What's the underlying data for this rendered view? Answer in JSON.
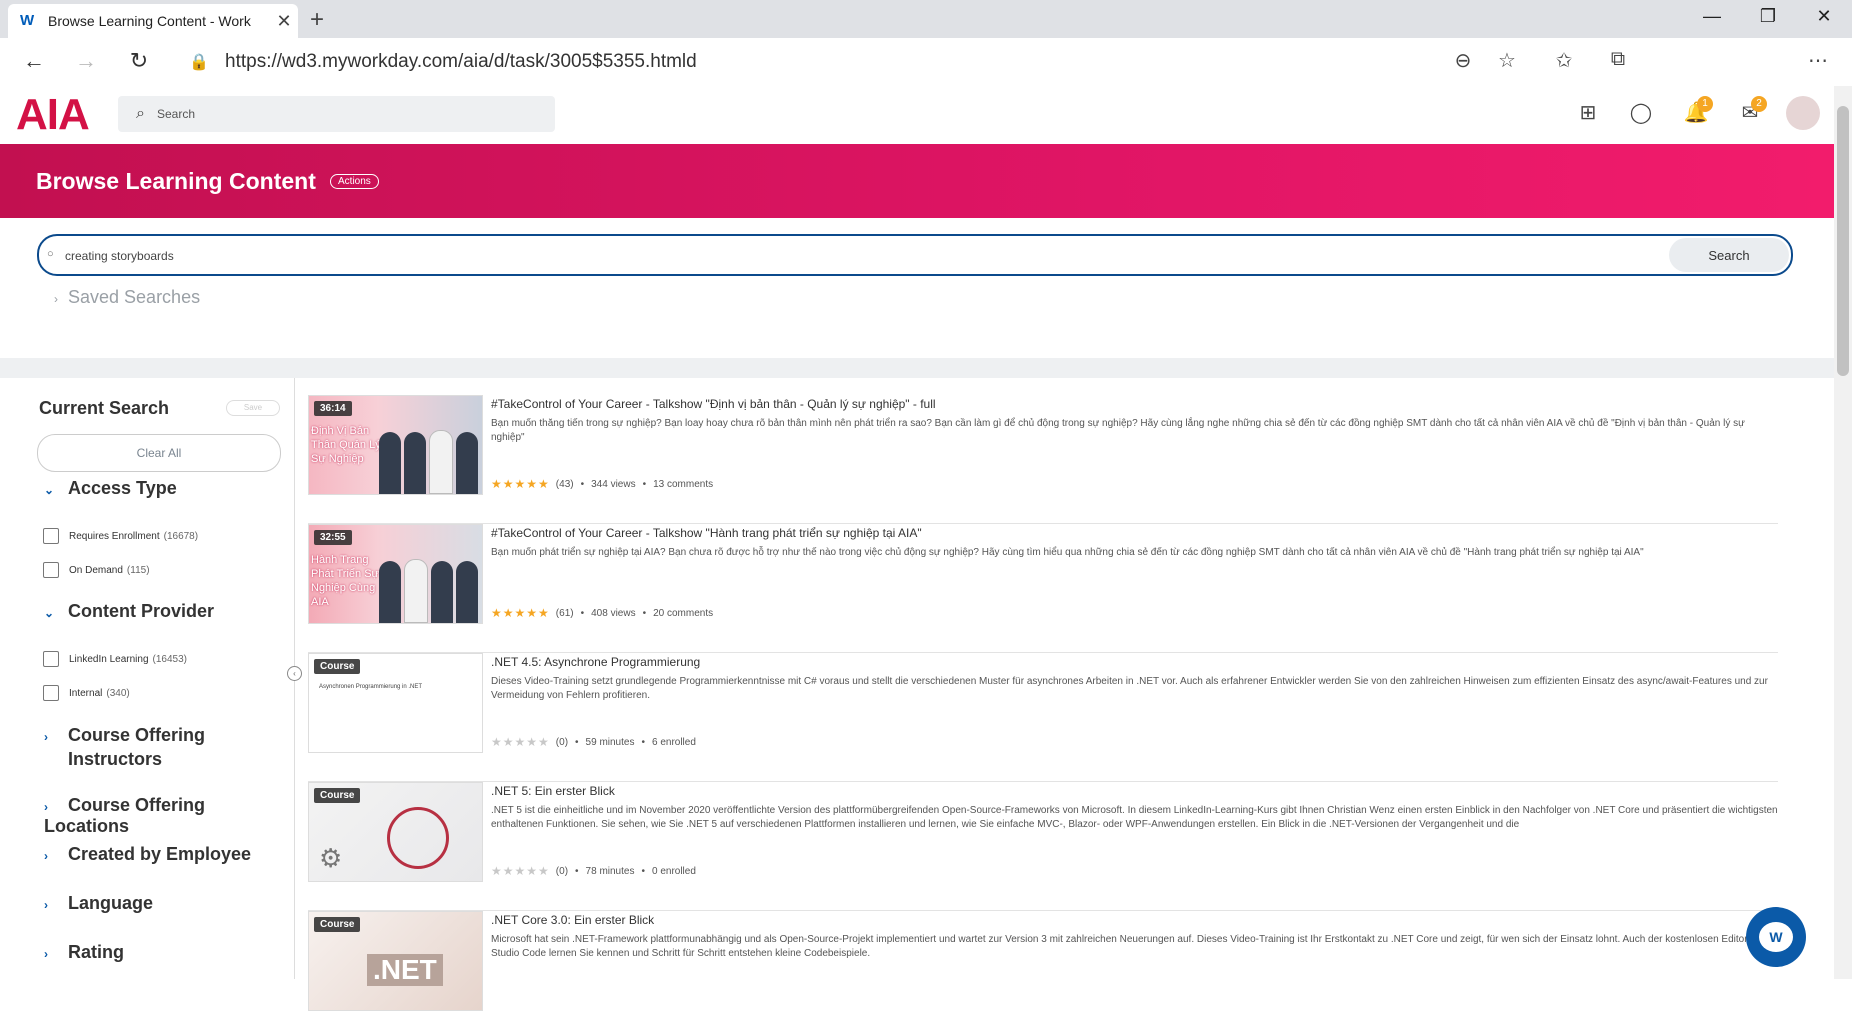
{
  "browser": {
    "tab_title": "Browse Learning Content - Work",
    "tab_favicon": "W",
    "url": "https://wd3.myworkday.com/aia/d/task/3005$5355.htmld"
  },
  "header": {
    "logo": "AIA",
    "search_placeholder": "Search",
    "notifications_badge": "1",
    "inbox_badge": "2"
  },
  "banner": {
    "title": "Browse Learning Content",
    "actions_label": "Actions"
  },
  "search": {
    "value": "creating storyboards",
    "button": "Search",
    "saved_searches": "Saved Searches"
  },
  "sidebar": {
    "current_search": "Current Search",
    "save_label": "Save",
    "clear_all": "Clear All",
    "facets": {
      "access_type": "Access Type",
      "content_provider": "Content Provider",
      "course_offering_instructors_1": "Course Offering",
      "course_offering_instructors_2": "Instructors",
      "course_offering_locations": "Course Offering Locations",
      "created_by_employee": "Created by Employee",
      "language": "Language",
      "rating": "Rating"
    },
    "options": {
      "requires_enrollment": "Requires Enrollment",
      "requires_enrollment_count": "(16678)",
      "on_demand": "On Demand",
      "on_demand_count": "(115)",
      "linkedin": "LinkedIn Learning",
      "linkedin_count": "(16453)",
      "internal": "Internal",
      "internal_count": "(340)"
    }
  },
  "results": [
    {
      "tag": "36:14",
      "thumb_caption": "Định Vị Bản Thân Quản Lý Sự Nghiệp",
      "title": "#TakeControl of Your Career - Talkshow \"Định vị bản thân - Quản lý sự nghiệp\" - full",
      "description": "Bạn muốn thăng tiến trong sự nghiệp? Bạn loay hoay chưa rõ bản thân mình nên phát triển ra sao? Bạn cần làm gì để chủ động trong sự nghiệp? Hãy cùng lắng nghe những chia sẻ đến từ các đồng nghiệp SMT dành cho tất cả nhân viên AIA về chủ đề \"Định vị bản thân - Quản lý sự nghiệp\"",
      "stars": "★★★★★",
      "rating_count": "(43)",
      "stat2": "344 views",
      "stat3": "13 comments"
    },
    {
      "tag": "32:55",
      "thumb_caption": "Hành Trang Phát Triển Sự Nghiệp Cùng AIA",
      "title": "#TakeControl of Your Career - Talkshow \"Hành trang phát triển sự nghiệp tại AIA\"",
      "description": "Bạn muốn phát triển sự nghiệp tại AIA? Bạn chưa rõ được hỗ trợ như thế nào trong việc chủ động sự nghiệp? Hãy cùng tìm hiểu qua những chia sẻ đến từ các đồng nghiệp SMT dành cho tất cả nhân viên AIA về chủ đề \"Hành trang phát triển sự nghiệp tại AIA\"",
      "stars": "★★★★★",
      "rating_count": "(61)",
      "stat2": "408 views",
      "stat3": "20 comments"
    },
    {
      "tag": "Course",
      "thumb_caption": "Asynchronen Programmierung in .NET",
      "title": ".NET 4.5: Asynchrone Programmierung",
      "description": "Dieses Video-Training setzt grundlegende Programmierkenntnisse mit C# voraus und stellt die verschiedenen Muster für asynchrones Arbeiten in .NET vor. Auch als erfahrener Entwickler werden Sie von den zahlreichen Hinweisen zum effizienten Einsatz des async/await-Features und zur Vermeidung von Fehlern profitieren.",
      "stars": "★★★★★",
      "rating_count": "(0)",
      "stat2": "59 minutes",
      "stat3": "6 enrolled"
    },
    {
      "tag": "Course",
      "title": ".NET 5: Ein erster Blick",
      "description": ".NET 5 ist die einheitliche und im November 2020 veröffentlichte Version des plattformübergreifenden Open-Source-Frameworks von Microsoft. In diesem LinkedIn-Learning-Kurs gibt Ihnen Christian Wenz einen ersten Einblick in den Nachfolger von .NET Core und präsentiert die wichtigsten enthaltenen Funktionen. Sie sehen, wie Sie .NET 5 auf verschiedenen Plattformen installieren und lernen, wie Sie einfache MVC-, Blazor- oder WPF-Anwendungen erstellen. Ein Blick in die .NET-Versionen der Vergangenheit und die",
      "stars": "★★★★★",
      "rating_count": "(0)",
      "stat2": "78 minutes",
      "stat3": "0 enrolled"
    },
    {
      "tag": "Course",
      "thumb_caption": ".NET",
      "title": ".NET Core 3.0: Ein erster Blick",
      "description": "Microsoft hat sein .NET-Framework plattformunabhängig und als Open-Source-Projekt implementiert und wartet zur Version 3 mit zahlreichen Neuerungen auf. Dieses Video-Training ist Ihr Erstkontakt zu .NET Core und zeigt, für wen sich der Einsatz lohnt. Auch der kostenlosen Editor Visual Studio Code lernen Sie kennen und Schritt für Schritt entstehen kleine Codebeispiele.",
      "stars": "★★★★★",
      "rating_count": "",
      "stat2": "",
      "stat3": ""
    }
  ],
  "colors": {
    "brand": "#d31145",
    "accent": "#0b5aa8",
    "star": "#f5a623"
  }
}
